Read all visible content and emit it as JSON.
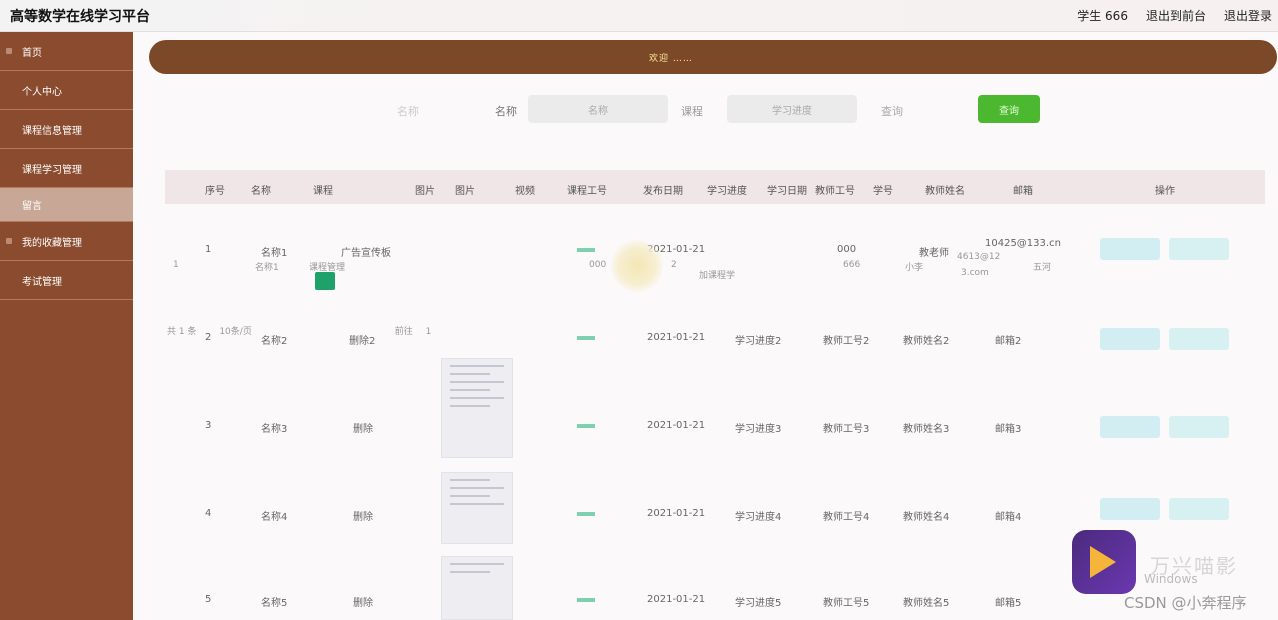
{
  "header": {
    "title": "高等数学在线学习平台",
    "user": "学生 666",
    "back_link": "退出到前台",
    "logout_link": "退出登录"
  },
  "sidebar": {
    "items": [
      {
        "label": "首页"
      },
      {
        "label": "个人中心"
      },
      {
        "label": "课程信息管理"
      },
      {
        "label": "课程学习管理"
      },
      {
        "label": "留言"
      },
      {
        "label": "我的收藏管理"
      },
      {
        "label": "考试管理"
      }
    ]
  },
  "banner": {
    "text": "欢迎 ……"
  },
  "search": {
    "label_ghost": "名称",
    "label": "名称",
    "input1_placeholder": "名称",
    "label2": "课程",
    "input2_placeholder": "学习进度",
    "label3": "查询",
    "button": "查询"
  },
  "table": {
    "headers": [
      "序号",
      "名称",
      "课程",
      "图片",
      "图片",
      "视频",
      "课程工号",
      "发布日期",
      "学习进度",
      "学习日期",
      "教师工号",
      "学号",
      "教师姓名",
      "邮箱",
      "操作"
    ],
    "rows": [
      {
        "index": "1",
        "name": "名称1",
        "course": "广告宣传板",
        "date": "2021-01-21",
        "teacher_no": "000",
        "teacher": "教老师",
        "email": "10425@133.cn"
      },
      {
        "index": "2",
        "name": "名称2",
        "course": "删除2",
        "date": "2021-01-21",
        "progress": "学习进度2",
        "teacher_no": "教师工号2",
        "teacher": "教师姓名2",
        "email": "邮箱2"
      },
      {
        "index": "3",
        "name": "名称3",
        "course": "删除",
        "date": "2021-01-21",
        "progress": "学习进度3",
        "teacher_no": "教师工号3",
        "teacher": "教师姓名3",
        "email": "邮箱3"
      },
      {
        "index": "4",
        "name": "名称4",
        "course": "删除",
        "date": "2021-01-21",
        "progress": "学习进度4",
        "teacher_no": "教师工号4",
        "teacher": "教师姓名4",
        "email": "邮箱4"
      },
      {
        "index": "5",
        "name": "名称5",
        "course": "删除",
        "date": "2021-01-21",
        "progress": "学习进度5",
        "teacher_no": "教师工号5",
        "teacher": "教师姓名5",
        "email": "邮箱5"
      }
    ]
  },
  "overlay": {
    "row_a": [
      "1",
      "名称1",
      "课程管理",
      "000",
      "2",
      "加课程学",
      "666",
      "小李",
      "4613@12",
      "五河"
    ],
    "email_b": "3.com",
    "pager_total": "共 1 条",
    "pager_size": "10条/页",
    "pager_prev": "前往",
    "pager_page": "1"
  },
  "watermark": {
    "brand": "万兴喵影",
    "win": "Windows",
    "csdn": "CSDN @小奔程序"
  }
}
